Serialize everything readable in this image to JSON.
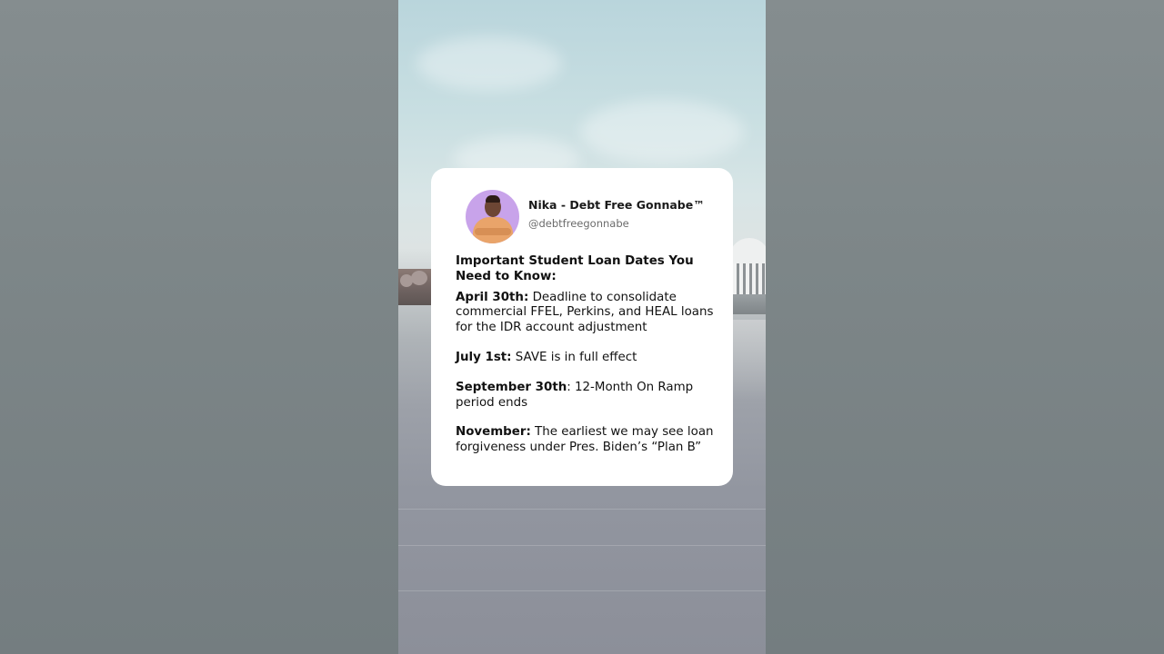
{
  "profile": {
    "name": "Nika - Debt Free Gonnabe™",
    "handle": "@debtfreegonnabe"
  },
  "post": {
    "heading": "Important Student Loan Dates You Need to Know:",
    "items": [
      {
        "date": "April 30th:",
        "text": " Deadline to consolidate commercial FFEL, Perkins, and HEAL loans for the IDR account adjustment"
      },
      {
        "date": "July 1st:",
        "text": " SAVE is in full effect"
      },
      {
        "date": "September 30th",
        "text": ": 12-Month On Ramp period ends"
      },
      {
        "date": "November:",
        "text": " The earliest we may see loan forgiveness under Pres. Biden’s “Plan B”"
      }
    ]
  },
  "colors": {
    "avatar_background": "#c8a3ea",
    "card_background": "#ffffff",
    "text": "#111111",
    "handle_text": "#6b6b6b"
  },
  "icons": {
    "avatar": "profile-photo"
  }
}
